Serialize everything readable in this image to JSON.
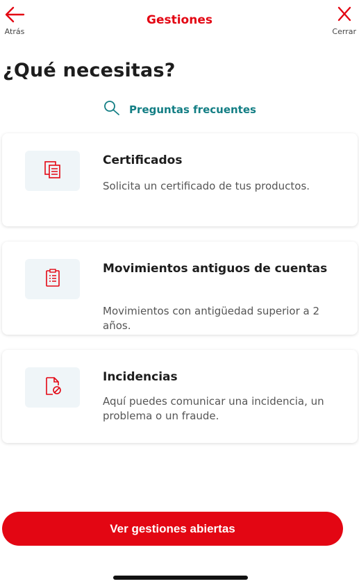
{
  "header": {
    "back_label": "Atrás",
    "title": "Gestiones",
    "close_label": "Cerrar"
  },
  "headline": "¿Qué necesitas?",
  "faq": {
    "label": "Preguntas frecuentes",
    "icon": "search-icon"
  },
  "cards": [
    {
      "title": "Certificados",
      "description": "Solicita un certificado de tus productos.",
      "icon": "documents-icon"
    },
    {
      "title": "Movimientos antiguos de cuentas",
      "description": "Movimientos con antigüedad superior a 2 años.",
      "icon": "clipboard-list-icon"
    },
    {
      "title": "Incidencias",
      "description": "Aquí puedes comunicar una incidencia, un problema o un fraude.",
      "icon": "document-blocked-icon"
    }
  ],
  "cta": {
    "label": "Ver gestiones abiertas"
  },
  "colors": {
    "brand_red": "#e30613",
    "teal": "#137e84",
    "icon_bg": "#eff5f8"
  }
}
